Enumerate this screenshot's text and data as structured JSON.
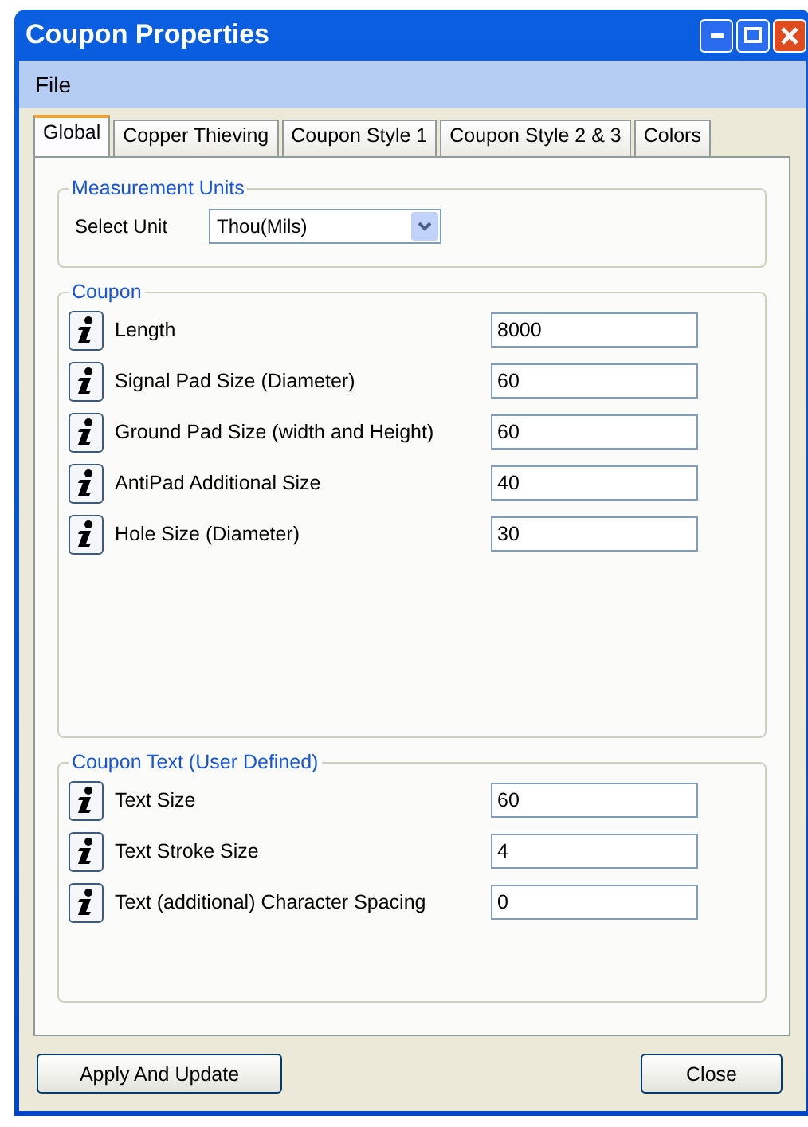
{
  "window": {
    "title": "Coupon Properties"
  },
  "menu": [
    "File"
  ],
  "tabs": [
    {
      "label": "Global",
      "selected": true
    },
    {
      "label": "Copper Thieving",
      "selected": false
    },
    {
      "label": "Coupon Style 1",
      "selected": false
    },
    {
      "label": "Coupon Style 2 & 3",
      "selected": false
    },
    {
      "label": "Colors",
      "selected": false
    }
  ],
  "units": {
    "title": "Measurement Units",
    "label": "Select Unit",
    "value": "Thou(Mils)"
  },
  "groups": [
    {
      "title": "Coupon",
      "rows": [
        {
          "label": "Length",
          "value": "8000"
        },
        {
          "label": "Signal Pad Size (Diameter)",
          "value": "60"
        },
        {
          "label": "Ground Pad Size (width and Height)",
          "value": "60"
        },
        {
          "label": "AntiPad Additional Size",
          "value": "40"
        },
        {
          "label": "Hole Size (Diameter)",
          "value": "30"
        }
      ]
    },
    {
      "title": "Coupon Text (User Defined)",
      "rows": [
        {
          "label": "Text Size",
          "value": "60"
        },
        {
          "label": "Text Stroke Size",
          "value": "4"
        },
        {
          "label": "Text (additional) Character Spacing",
          "value": "0"
        }
      ]
    }
  ],
  "buttons": [
    "Apply And Update",
    "Close"
  ]
}
